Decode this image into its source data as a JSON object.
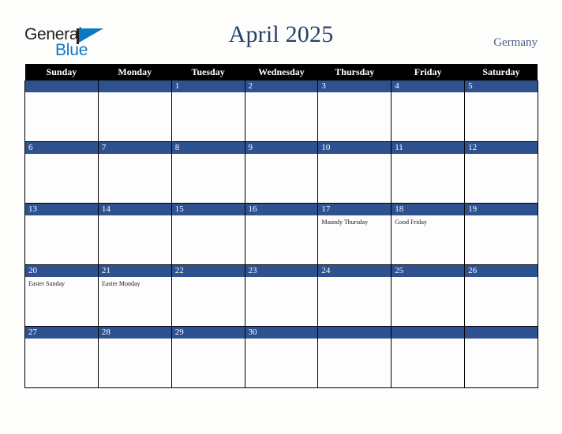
{
  "brand": {
    "word_one": "General",
    "word_two": "Blue",
    "flag_icon": "blue-triangle-flag-icon",
    "accent_color": "#0b79c4",
    "text_color": "#231f20"
  },
  "header": {
    "title": "April 2025",
    "country": "Germany",
    "title_color": "#28406b",
    "country_color": "#4a5f86"
  },
  "calendar": {
    "month": "April",
    "year": "2025",
    "weekday_headers": [
      "Sunday",
      "Monday",
      "Tuesday",
      "Wednesday",
      "Thursday",
      "Friday",
      "Saturday"
    ],
    "header_bg": "#000000",
    "header_fg": "#ffffff",
    "daynum_bar_color": "#2e5190",
    "daynum_text_color": "#ffffff",
    "cell_bg": "#fdfdfd",
    "grid_color": "#000000",
    "weeks": [
      [
        {
          "day": "",
          "events": []
        },
        {
          "day": "",
          "events": []
        },
        {
          "day": "1",
          "events": []
        },
        {
          "day": "2",
          "events": []
        },
        {
          "day": "3",
          "events": []
        },
        {
          "day": "4",
          "events": []
        },
        {
          "day": "5",
          "events": []
        }
      ],
      [
        {
          "day": "6",
          "events": []
        },
        {
          "day": "7",
          "events": []
        },
        {
          "day": "8",
          "events": []
        },
        {
          "day": "9",
          "events": []
        },
        {
          "day": "10",
          "events": []
        },
        {
          "day": "11",
          "events": []
        },
        {
          "day": "12",
          "events": []
        }
      ],
      [
        {
          "day": "13",
          "events": []
        },
        {
          "day": "14",
          "events": []
        },
        {
          "day": "15",
          "events": []
        },
        {
          "day": "16",
          "events": []
        },
        {
          "day": "17",
          "events": [
            "Maundy Thursday"
          ]
        },
        {
          "day": "18",
          "events": [
            "Good Friday"
          ]
        },
        {
          "day": "19",
          "events": []
        }
      ],
      [
        {
          "day": "20",
          "events": [
            "Easter Sunday"
          ]
        },
        {
          "day": "21",
          "events": [
            "Easter Monday"
          ]
        },
        {
          "day": "22",
          "events": []
        },
        {
          "day": "23",
          "events": []
        },
        {
          "day": "24",
          "events": []
        },
        {
          "day": "25",
          "events": []
        },
        {
          "day": "26",
          "events": []
        }
      ],
      [
        {
          "day": "27",
          "events": []
        },
        {
          "day": "28",
          "events": []
        },
        {
          "day": "29",
          "events": []
        },
        {
          "day": "30",
          "events": []
        },
        {
          "day": "",
          "events": []
        },
        {
          "day": "",
          "events": []
        },
        {
          "day": "",
          "events": []
        }
      ]
    ]
  }
}
